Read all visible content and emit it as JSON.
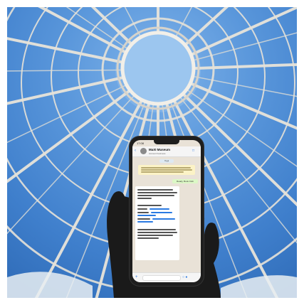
{
  "phone": {
    "status_time": "17:08",
    "chat_title": "MaXI Museum",
    "chat_subtitle": "Account business",
    "date_label": "Oggi",
    "outgoing_message": "Ready, Book Club",
    "back_icon": "chevron-left-icon",
    "camera_icon": "camera-icon",
    "attach_icon": "plus-icon"
  },
  "colors": {
    "sky": "#4f8fd6",
    "chat_background": "#e9e2d7",
    "outgoing_bubble": "#dcf8c6",
    "system_bubble": "#fcf3c6",
    "link": "#2a7ae2"
  }
}
